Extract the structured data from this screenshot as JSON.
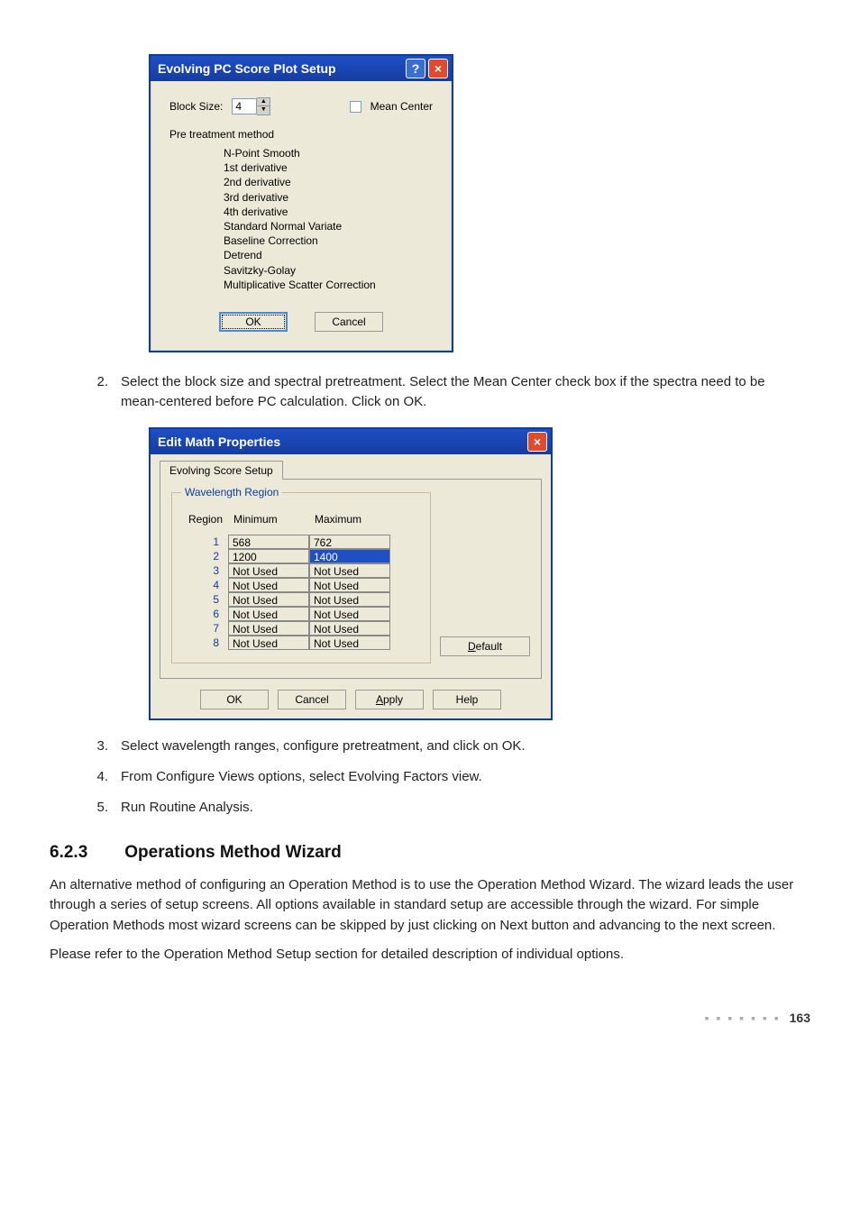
{
  "dlg1": {
    "title": "Evolving PC Score Plot Setup",
    "blockSizeLabel": "Block Size:",
    "blockSizeValue": "4",
    "meanCenterLabel": "Mean Center",
    "pretreatLabel": "Pre treatment method",
    "pretreatItems": [
      "N-Point Smooth",
      "1st derivative",
      "2nd derivative",
      "3rd derivative",
      "4th derivative",
      "Standard Normal Variate",
      "Baseline Correction",
      "Detrend",
      "Savitzky-Golay",
      "Multiplicative Scatter Correction"
    ],
    "ok": "OK",
    "cancel": "Cancel"
  },
  "step2": "Select the block size and spectral pretreatment. Select the Mean Center check box if the spectra need to be mean-centered before PC calculation. Click on OK.",
  "dlg2": {
    "title": "Edit Math Properties",
    "tab": "Evolving Score Setup",
    "fieldsetLegend": "Wavelength Region",
    "cols": {
      "region": "Region",
      "min": "Minimum",
      "max": "Maximum"
    },
    "rows": [
      {
        "n": "1",
        "min": "568",
        "max": "762",
        "sel": false
      },
      {
        "n": "2",
        "min": "1200",
        "max": "1400",
        "sel": true
      },
      {
        "n": "3",
        "min": "Not Used",
        "max": "Not Used",
        "sel": false
      },
      {
        "n": "4",
        "min": "Not Used",
        "max": "Not Used",
        "sel": false
      },
      {
        "n": "5",
        "min": "Not Used",
        "max": "Not Used",
        "sel": false
      },
      {
        "n": "6",
        "min": "Not Used",
        "max": "Not Used",
        "sel": false
      },
      {
        "n": "7",
        "min": "Not Used",
        "max": "Not Used",
        "sel": false
      },
      {
        "n": "8",
        "min": "Not Used",
        "max": "Not Used",
        "sel": false
      }
    ],
    "default": "Default",
    "ok": "OK",
    "cancel": "Cancel",
    "apply": "Apply",
    "help": "Help"
  },
  "step3": "Select wavelength ranges, configure pretreatment, and click on OK.",
  "step4": "From Configure Views options, select Evolving Factors view.",
  "step5": "Run Routine Analysis.",
  "section": {
    "num": "6.2.3",
    "title": "Operations Method Wizard",
    "p1": "An alternative method of configuring an Operation Method is to use the Operation Method Wizard. The wizard leads the user through a series of setup screens. All options available in standard setup are accessible through the wizard. For simple Operation Methods most wizard screens can be skipped by just clicking on Next button and advancing to the next screen.",
    "p2": "Please refer to the Operation Method Setup section for detailed description of individual options."
  },
  "pageNum": "163"
}
